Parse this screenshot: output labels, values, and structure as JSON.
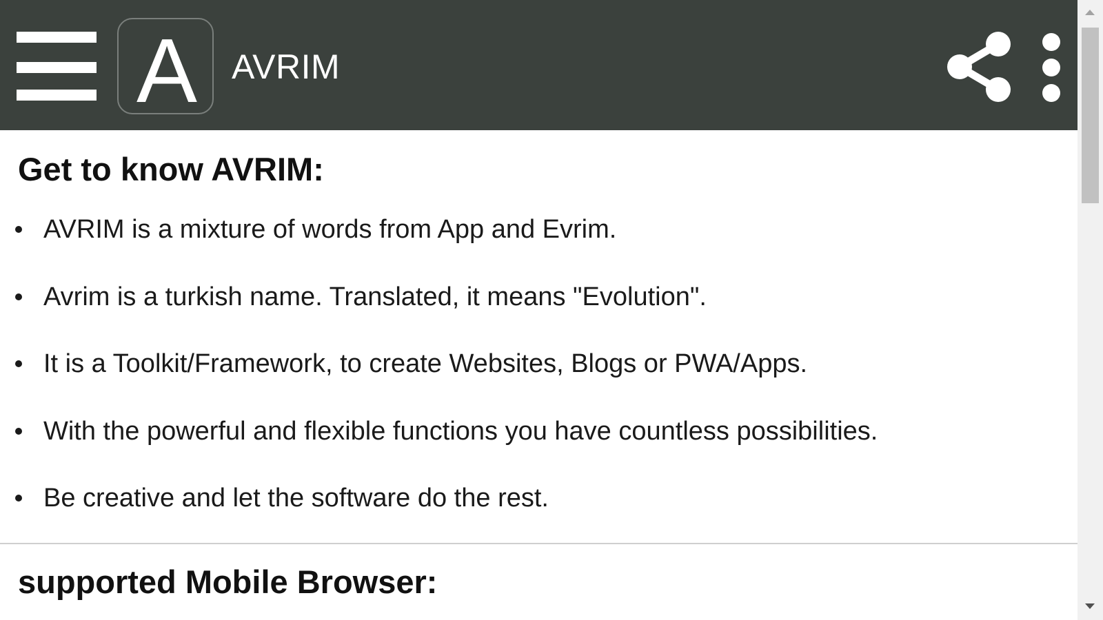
{
  "app_bar": {
    "title": "AVRIM",
    "logo_letter": "A",
    "menu_icon": "hamburger-menu-icon",
    "share_icon": "share-icon",
    "more_icon": "more-vertical-icon",
    "background_color": "#3b413d"
  },
  "sections": [
    {
      "heading": "Get to know AVRIM:",
      "items": [
        "AVRIM is a mixture of words from App and Evrim.",
        "Avrim is a turkish name. Translated, it means \"Evolution\".",
        "It is a Toolkit/Framework, to create Websites, Blogs or PWA/Apps.",
        "With the powerful and flexible functions you have countless possibilities.",
        "Be creative and let the software do the rest."
      ]
    },
    {
      "heading": "supported Mobile Browser:"
    }
  ]
}
